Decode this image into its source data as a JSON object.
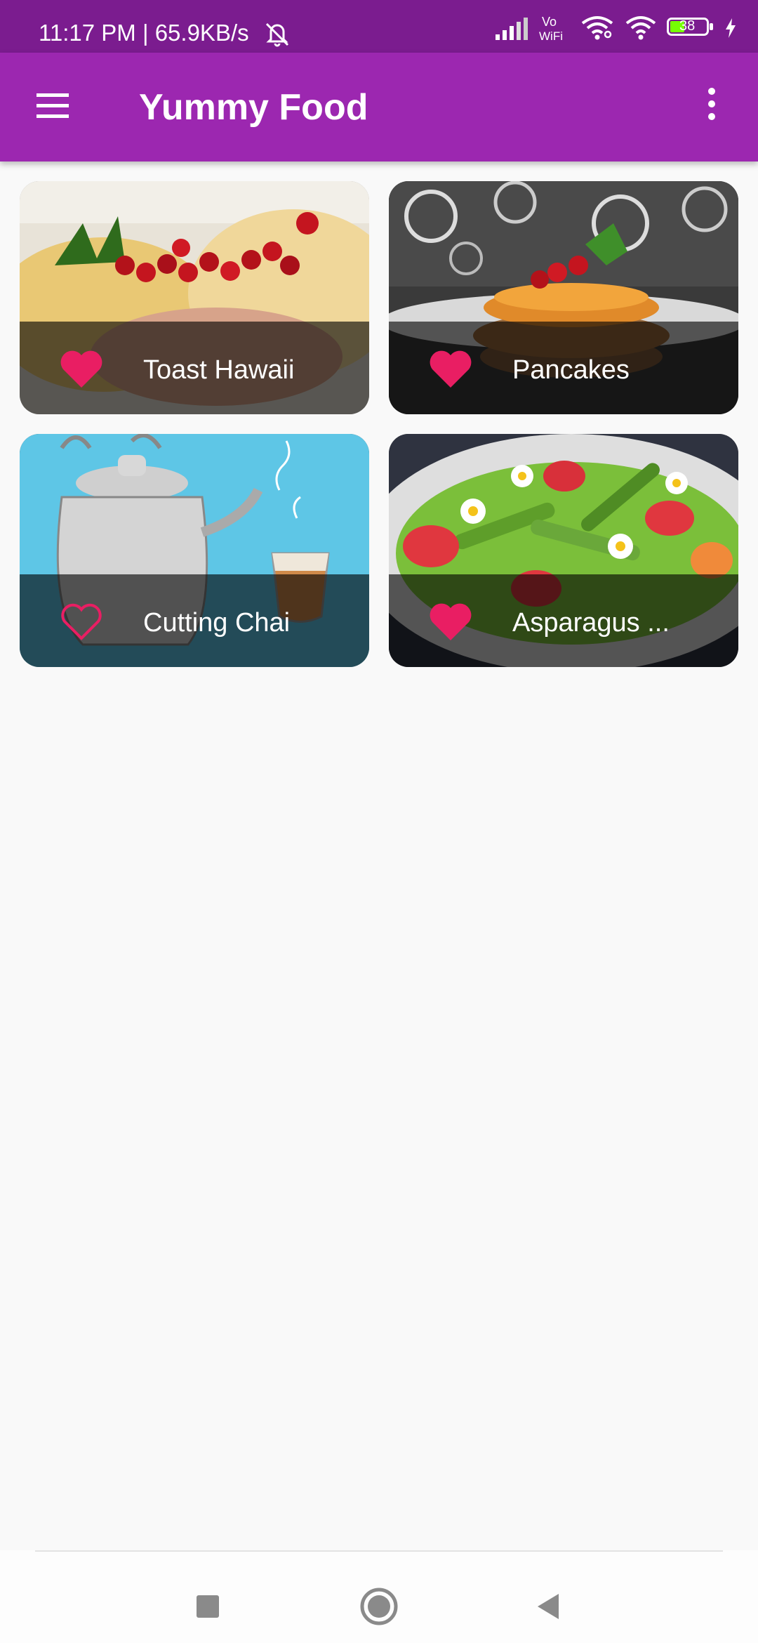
{
  "status": {
    "time_speed": "11:17 PM | 65.9KB/s",
    "vowifi": "Vo\nWiFi",
    "battery_level": "38",
    "icons": [
      "mute-icon",
      "signal-icon",
      "vowifi-icon",
      "wifi-icon",
      "wifi-icon",
      "battery-icon",
      "charging-icon"
    ]
  },
  "appbar": {
    "title": "Yummy Food",
    "menu_icon": "menu-icon",
    "more_icon": "more-vert-icon"
  },
  "meals": [
    {
      "name": "Toast Hawaii",
      "favorite": true
    },
    {
      "name": "Pancakes",
      "favorite": true
    },
    {
      "name": "Cutting Chai",
      "favorite": false
    },
    {
      "name": "Asparagus ...",
      "favorite": true
    }
  ],
  "navigation": [
    "recents-square-icon",
    "home-circle-icon",
    "back-triangle-icon"
  ],
  "colors": {
    "statusbar": "#7b1c8f",
    "appbar": "#9c27b0",
    "heart": "#e91e63",
    "background": "#f9f9f9"
  }
}
